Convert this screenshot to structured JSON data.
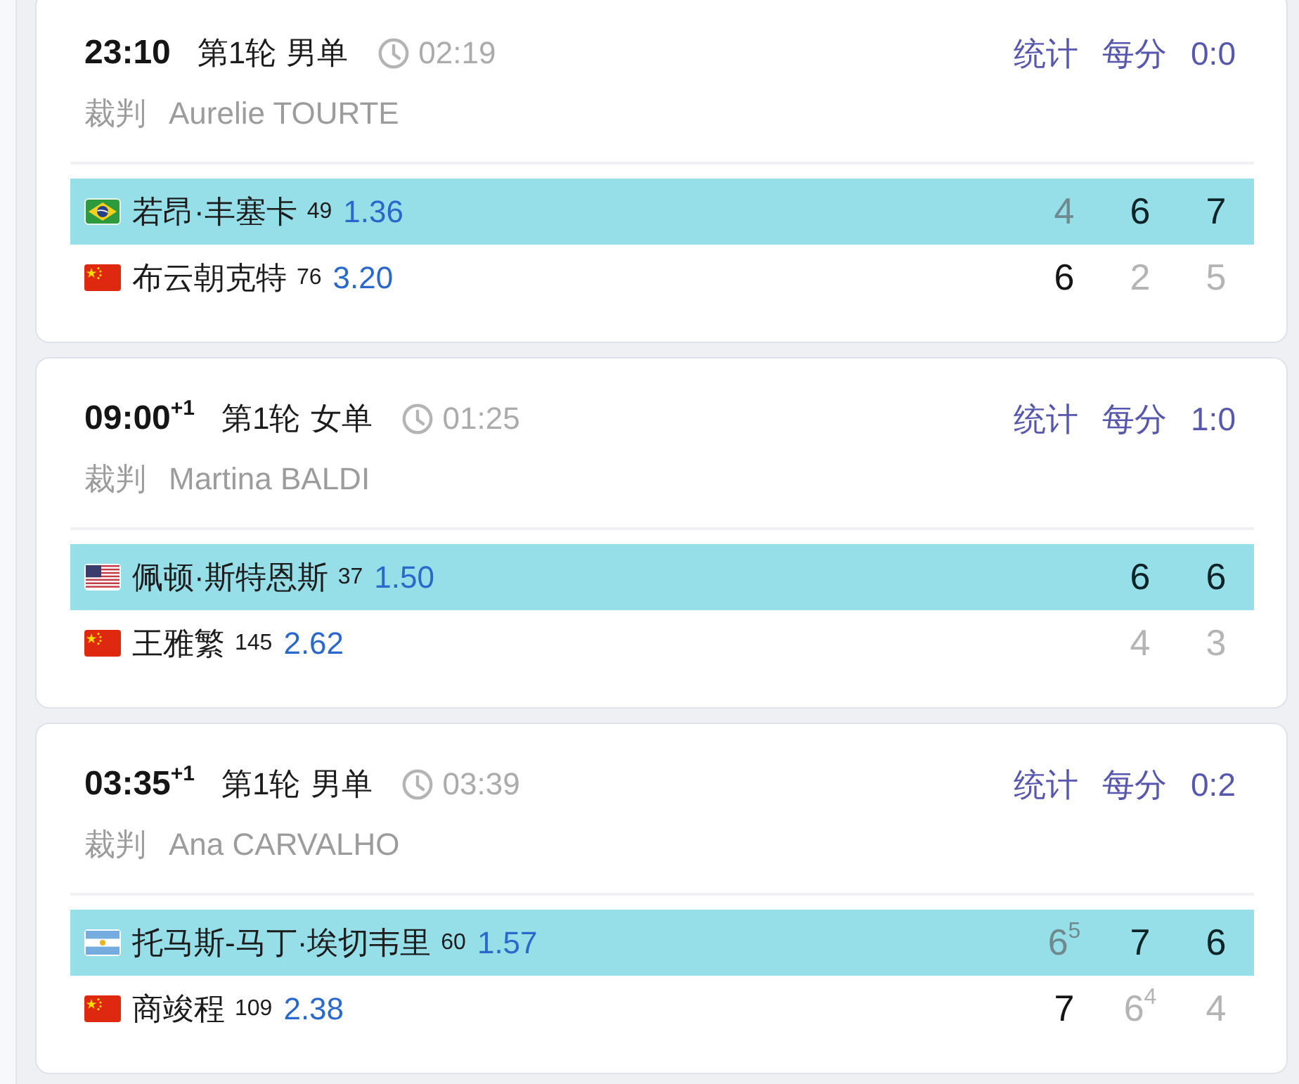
{
  "matches": [
    {
      "start_time": "23:10",
      "round": "第1轮",
      "event": "男单",
      "duration": "02:19",
      "referee_label": "裁判",
      "referee": "Aurelie TOURTE",
      "links": [
        "统计",
        "每分"
      ],
      "head_to_head": "0:0",
      "players": [
        {
          "kind": "brazil",
          "name": "若昂·丰塞卡",
          "rank": "49",
          "odds": "1.36",
          "winner": true,
          "sets": [
            {
              "score": "4",
              "won": false
            },
            {
              "score": "6",
              "won": true
            },
            {
              "score": "7",
              "won": true
            }
          ]
        },
        {
          "kind": "china",
          "name": "布云朝克特",
          "rank": "76",
          "odds": "3.20",
          "winner": false,
          "sets": [
            {
              "score": "6",
              "won": true
            },
            {
              "score": "2",
              "won": false
            },
            {
              "score": "5",
              "won": false
            }
          ]
        }
      ]
    },
    {
      "start_time": "09:00$^{+1}$",
      "round": "第1轮",
      "event": "女单",
      "duration": "01:25",
      "referee_label": "裁判",
      "referee": "Martina BALDI",
      "links": [
        "统计",
        "每分"
      ],
      "head_to_head": "1:0",
      "players": [
        {
          "kind": "usa",
          "name": "佩顿·斯特恩斯",
          "rank": "37",
          "odds": "1.50",
          "winner": true,
          "sets": [
            {
              "score": "6",
              "won": true
            },
            {
              "score": "6",
              "won": true
            }
          ]
        },
        {
          "kind": "china",
          "name": "王雅繁",
          "rank": "145",
          "odds": "2.62",
          "winner": false,
          "sets": [
            {
              "score": "4",
              "won": false
            },
            {
              "score": "3",
              "won": false
            }
          ]
        }
      ]
    },
    {
      "start_time": "03:35$^{+1}$",
      "round": "第1轮",
      "event": "男单",
      "duration": "03:39",
      "referee_label": "裁判",
      "referee": "Ana CARVALHO",
      "links": [
        "统计",
        "每分"
      ],
      "head_to_head": "0:2",
      "players": [
        {
          "kind": "argentina",
          "name": "托马斯-马丁·埃切韦里",
          "rank": "60",
          "odds": "1.57",
          "winner": true,
          "sets": [
            {
              "score": "6$^{5}$",
              "won": false
            },
            {
              "score": "7",
              "won": true
            },
            {
              "score": "6",
              "won": true
            }
          ]
        },
        {
          "kind": "china",
          "name": "商竣程",
          "rank": "109",
          "odds": "2.38",
          "winner": false,
          "sets": [
            {
              "score": "7",
              "won": true
            },
            {
              "score": "6$^{4}$",
              "won": false
            },
            {
              "score": "4",
              "won": false
            }
          ]
        }
      ]
    }
  ]
}
